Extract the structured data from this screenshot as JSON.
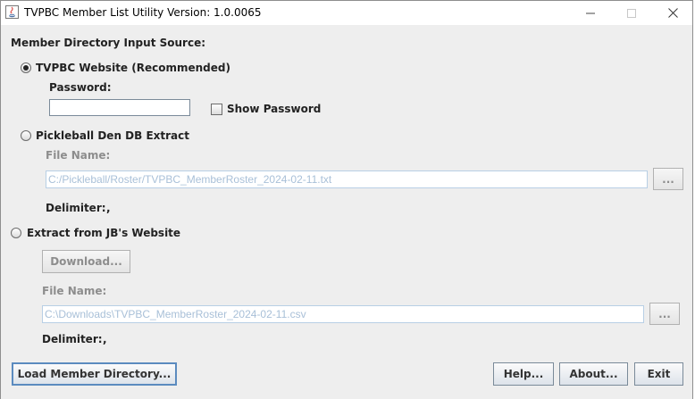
{
  "window": {
    "title": "TVPBC Member List Utility Version: 1.0.0065"
  },
  "form": {
    "section_label": "Member Directory Input Source:",
    "website_option": {
      "label": "TVPBC Website (Recommended)",
      "selected": true
    },
    "password_label": "Password:",
    "password_value": "",
    "show_password": {
      "label": "Show Password",
      "checked": false
    },
    "pickleball_option": {
      "label": "Pickleball Den DB Extract",
      "selected": false
    },
    "pickleball_file_label": "File Name:",
    "pickleball_file_value": "C:/Pickleball/Roster/TVPBC_MemberRoster_2024-02-11.txt",
    "pickleball_browse_label": "...",
    "pickleball_delimiter_label": "Delimiter:",
    "pickleball_delimiter_value": ",",
    "jb_option": {
      "label": "Extract from JB's Website",
      "selected": false
    },
    "download_label": "Download...",
    "jb_file_label": "File Name:",
    "jb_file_value": "C:\\Downloads\\TVPBC_MemberRoster_2024-02-11.csv",
    "jb_browse_label": "...",
    "jb_delimiter_label": "Delimiter:",
    "jb_delimiter_value": ","
  },
  "footer": {
    "load_label": "Load Member Directory...",
    "help_label": "Help...",
    "about_label": "About...",
    "exit_label": "Exit"
  }
}
